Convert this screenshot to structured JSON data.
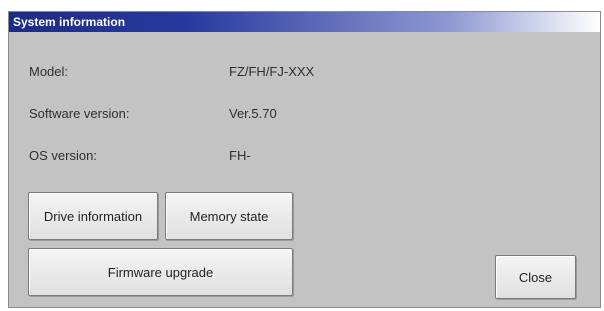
{
  "window": {
    "title": "System information"
  },
  "info": [
    {
      "label": "Model:",
      "value": "FZ/FH/FJ-XXX"
    },
    {
      "label": "Software version:",
      "value": "Ver.5.70"
    },
    {
      "label": "OS version:",
      "value": "FH-"
    }
  ],
  "buttons": {
    "drive_information": "Drive information",
    "memory_state": "Memory state",
    "firmware_upgrade": "Firmware upgrade",
    "close": "Close"
  },
  "colors": {
    "titlebar_start": "#1c2c84",
    "dialog_background": "#c3c3c3",
    "button_face": "#e8e8e8"
  }
}
